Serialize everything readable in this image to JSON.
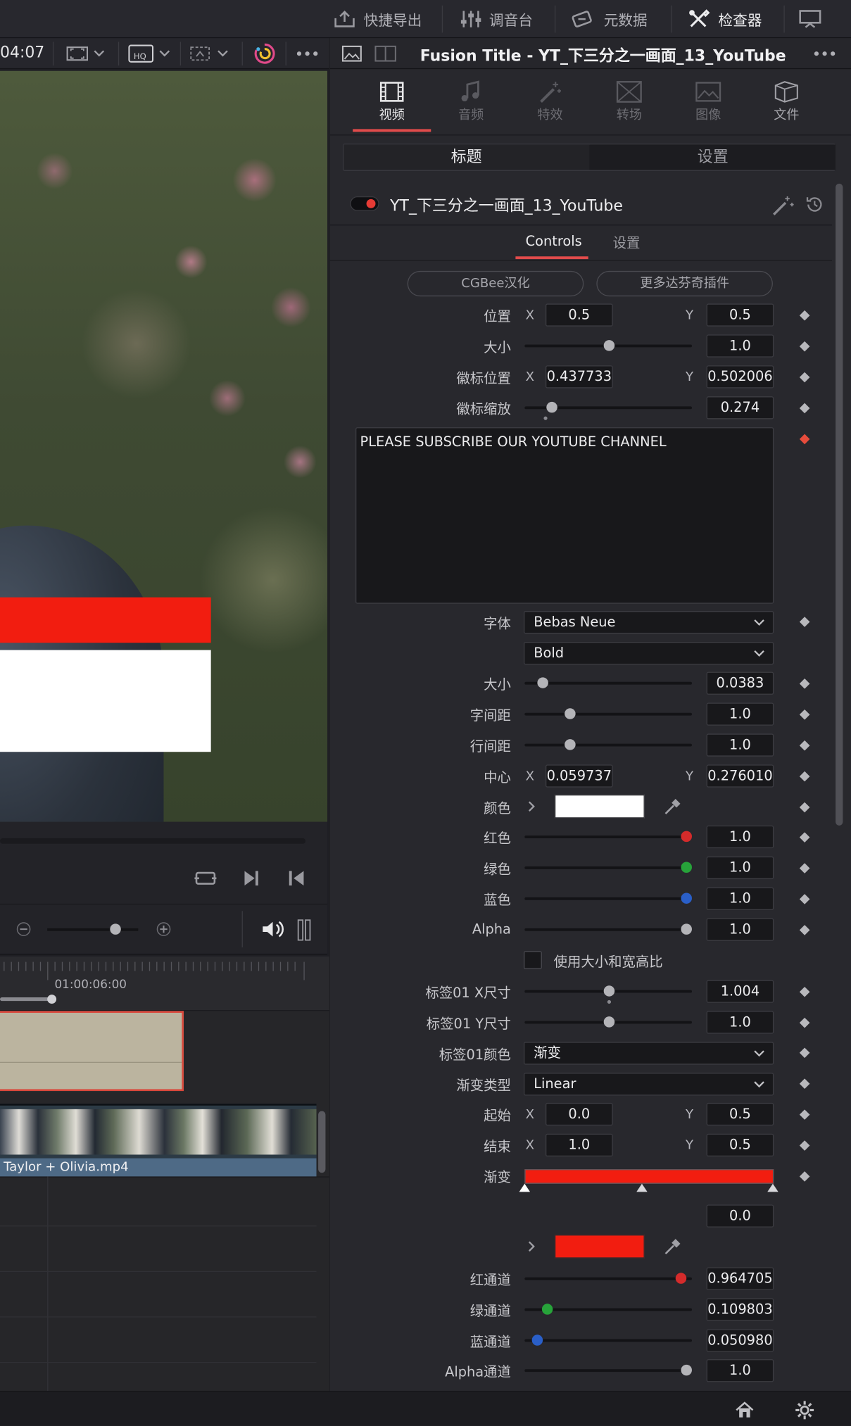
{
  "topbar": {
    "quick_export": "快捷导出",
    "mixer": "调音台",
    "metadata": "元数据",
    "inspector": "检查器"
  },
  "viewer": {
    "timecode": "04:07"
  },
  "timeline": {
    "ruler_time": "01:00:06:00",
    "clip_name": "Taylor + Olivia.mp4"
  },
  "inspector": {
    "title": "Fusion Title - YT_下三分之一画面_13_YouTube",
    "tabs": [
      {
        "label": "视频",
        "icon": "film-icon"
      },
      {
        "label": "音频",
        "icon": "music-note-icon"
      },
      {
        "label": "特效",
        "icon": "magic-wand-icon"
      },
      {
        "label": "转场",
        "icon": "transition-icon"
      },
      {
        "label": "图像",
        "icon": "image-icon"
      },
      {
        "label": "文件",
        "icon": "file-icon"
      }
    ],
    "segments": [
      "标题",
      "设置"
    ],
    "node_name": "YT_下三分之一画面_13_YouTube",
    "subtabs": [
      "Controls",
      "设置"
    ],
    "pills": [
      "CGBee汉化",
      "更多达芬奇插件"
    ],
    "axis_x": "X",
    "axis_y": "Y",
    "text_content": "PLEASE SUBSCRIBE OUR YOUTUBE CHANNEL",
    "labels": {
      "position": "位置",
      "size": "大小",
      "logo_position": "徽标位置",
      "logo_scale": "徽标缩放",
      "font": "字体",
      "text_size": "大小",
      "tracking": "字间距",
      "line_spacing": "行间距",
      "center": "中心",
      "color": "颜色",
      "red": "红色",
      "green": "绿色",
      "blue": "蓝色",
      "alpha": "Alpha",
      "use_size_aspect": "使用大小和宽高比",
      "label01_x": "标签01 X尺寸",
      "label01_y": "标签01 Y尺寸",
      "label01_color": "标签01颜色",
      "gradient_type": "渐变类型",
      "start": "起始",
      "end": "结束",
      "gradient": "渐变",
      "red_channel": "红通道",
      "green_channel": "绿通道",
      "blue_channel": "蓝通道",
      "alpha_channel": "Alpha通道"
    },
    "values": {
      "position_x": "0.5",
      "position_y": "0.5",
      "size": "1.0",
      "logo_x": "0.437733",
      "logo_y": "0.502006",
      "logo_scale": "0.274",
      "font_family": "Bebas Neue",
      "font_style": "Bold",
      "text_size": "0.0383",
      "tracking": "1.0",
      "line_spacing": "1.0",
      "center_x": "0.059737",
      "center_y": "0.276010",
      "red": "1.0",
      "green": "1.0",
      "blue": "1.0",
      "alpha": "1.0",
      "label01_x": "1.004",
      "label01_y": "1.0",
      "label01_color": "渐变",
      "gradient_type": "Linear",
      "start_x": "0.0",
      "start_y": "0.5",
      "end_x": "1.0",
      "end_y": "0.5",
      "gradient_pos": "0.0",
      "red_channel": "0.964705",
      "green_channel": "0.109803",
      "blue_channel": "0.050980",
      "alpha_channel": "1.0"
    }
  },
  "colors": {
    "accent": "#e14b4b",
    "title_red": "#f21d10",
    "title_white": "#ffffff",
    "panel": "#28282d"
  }
}
